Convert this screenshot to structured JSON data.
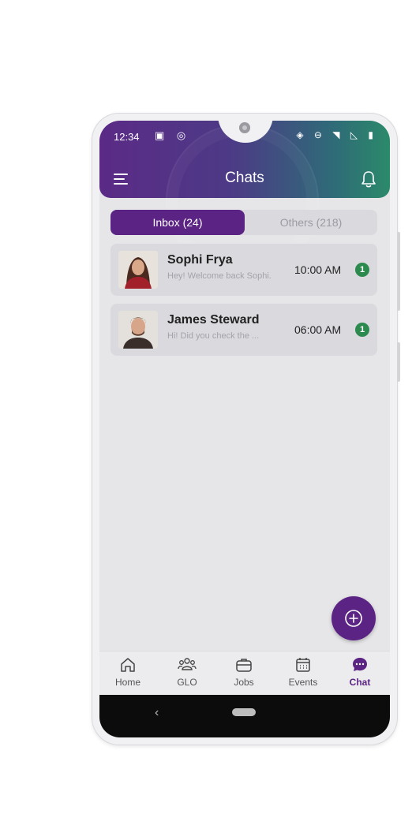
{
  "status_bar": {
    "time": "12:34"
  },
  "header": {
    "title": "Chats"
  },
  "tabs": [
    {
      "label": "Inbox (24)",
      "active": true
    },
    {
      "label": "Others (218)",
      "active": false
    }
  ],
  "chats": [
    {
      "name": "Sophi Frya",
      "preview": "Hey! Welcome back Sophi.",
      "time": "10:00 AM",
      "unread": "1"
    },
    {
      "name": "James Steward",
      "preview": "Hi! Did you check the ...",
      "time": "06:00 AM",
      "unread": "1"
    }
  ],
  "bottom_nav": [
    {
      "label": "Home",
      "icon": "home-icon",
      "active": false
    },
    {
      "label": "GLO",
      "icon": "group-icon",
      "active": false
    },
    {
      "label": "Jobs",
      "icon": "briefcase-icon",
      "active": false
    },
    {
      "label": "Events",
      "icon": "calendar-icon",
      "active": false
    },
    {
      "label": "Chat",
      "icon": "chat-icon",
      "active": true
    }
  ],
  "colors": {
    "brand_purple": "#5b2484",
    "header_gradient_end": "#2b8a6a",
    "badge_green": "#2d8a4e"
  }
}
